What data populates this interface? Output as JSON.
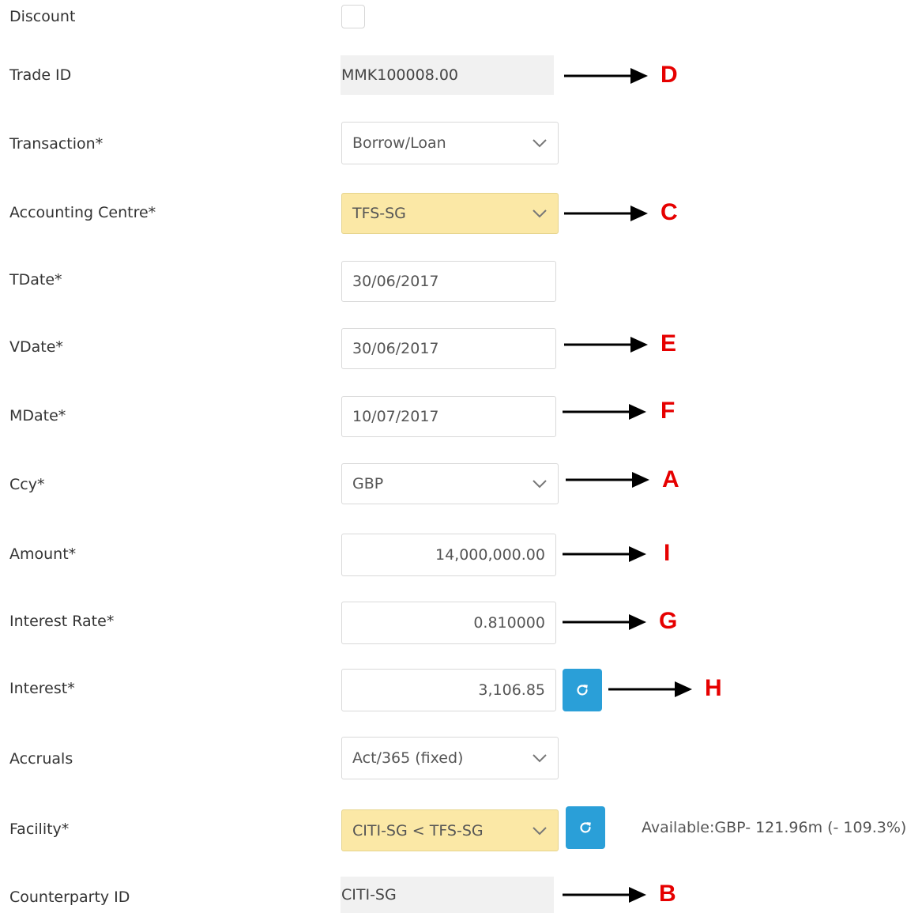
{
  "form": {
    "discount": {
      "label": "Discount",
      "checked": false
    },
    "trade_id": {
      "label": "Trade ID",
      "value": "MMK100008.00"
    },
    "transaction": {
      "label": "Transaction*",
      "value": "Borrow/Loan"
    },
    "accounting_centre": {
      "label": "Accounting Centre*",
      "value": "TFS-SG"
    },
    "tdate": {
      "label": "TDate*",
      "value": "30/06/2017"
    },
    "vdate": {
      "label": "VDate*",
      "value": "30/06/2017"
    },
    "mdate": {
      "label": "MDate*",
      "value": "10/07/2017"
    },
    "ccy": {
      "label": "Ccy*",
      "value": "GBP"
    },
    "amount": {
      "label": "Amount*",
      "value": "14,000,000.00"
    },
    "interest_rate": {
      "label": "Interest Rate*",
      "value": "0.810000"
    },
    "interest": {
      "label": "Interest*",
      "value": "3,106.85"
    },
    "accruals": {
      "label": "Accruals",
      "value": "Act/365 (fixed)"
    },
    "facility": {
      "label": "Facility*",
      "value": "CITI-SG < TFS-SG",
      "available": "Available:GBP- 121.96m (- 109.3%)"
    },
    "counterparty_id": {
      "label": "Counterparty ID",
      "value": "CITI-SG"
    }
  },
  "annotations": {
    "d": "D",
    "c": "C",
    "e": "E",
    "f": "F",
    "a": "A",
    "i": "I",
    "g": "G",
    "h": "H",
    "b": "B"
  },
  "icons": {
    "dropdown": "chevron-down-icon",
    "refresh": "refresh-icon",
    "annotation_arrow": "arrow-right-icon"
  },
  "colors": {
    "highlight": "#fbe8a6",
    "readonly_bg": "#f1f1f1",
    "button": "#2a9fd8",
    "annotation": "#e60000"
  }
}
